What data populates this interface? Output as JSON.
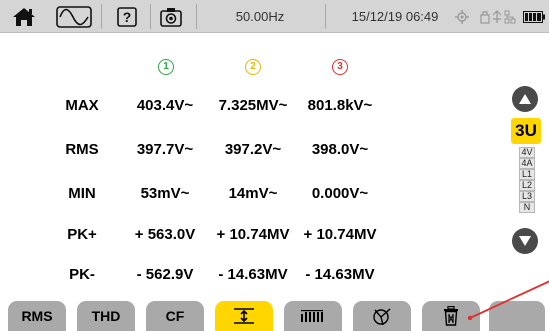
{
  "status_bar": {
    "frequency": "50.00Hz",
    "datetime": "15/12/19 06:49",
    "icons": [
      "home-icon",
      "waveform-icon",
      "help-icon",
      "camera-icon",
      "gps-icon",
      "connection-icon",
      "battery-icon"
    ]
  },
  "phases": [
    {
      "label": "1",
      "color": "#2ea84a"
    },
    {
      "label": "2",
      "color": "#e6b800"
    },
    {
      "label": "3",
      "color": "#e03030"
    }
  ],
  "rows": [
    {
      "label": "MAX",
      "values": [
        "403.4V~",
        "7.325MV~",
        "801.8kV~"
      ]
    },
    {
      "label": "RMS",
      "values": [
        "397.7V~",
        "397.2V~",
        "398.0V~"
      ]
    },
    {
      "label": "MIN",
      "values": [
        "53mV~",
        "14mV~",
        "0.000V~"
      ]
    },
    {
      "label": "PK+",
      "values": [
        "+ 563.0V",
        "+ 10.74MV",
        "+ 10.74MV"
      ]
    },
    {
      "label": "PK-",
      "values": [
        "- 562.9V",
        "- 14.63MV",
        "- 14.63MV"
      ]
    }
  ],
  "selector": {
    "active": "3U",
    "options": [
      "4V",
      "4A",
      "L1",
      "L2",
      "L3",
      "N"
    ]
  },
  "tabs": {
    "rms": "RMS",
    "thd": "THD",
    "cf": "CF"
  },
  "colors": {
    "status_bar": "#d5d5d5",
    "tab": "#a9a9a9",
    "active": "#ffd600",
    "callout": "#e03030"
  }
}
